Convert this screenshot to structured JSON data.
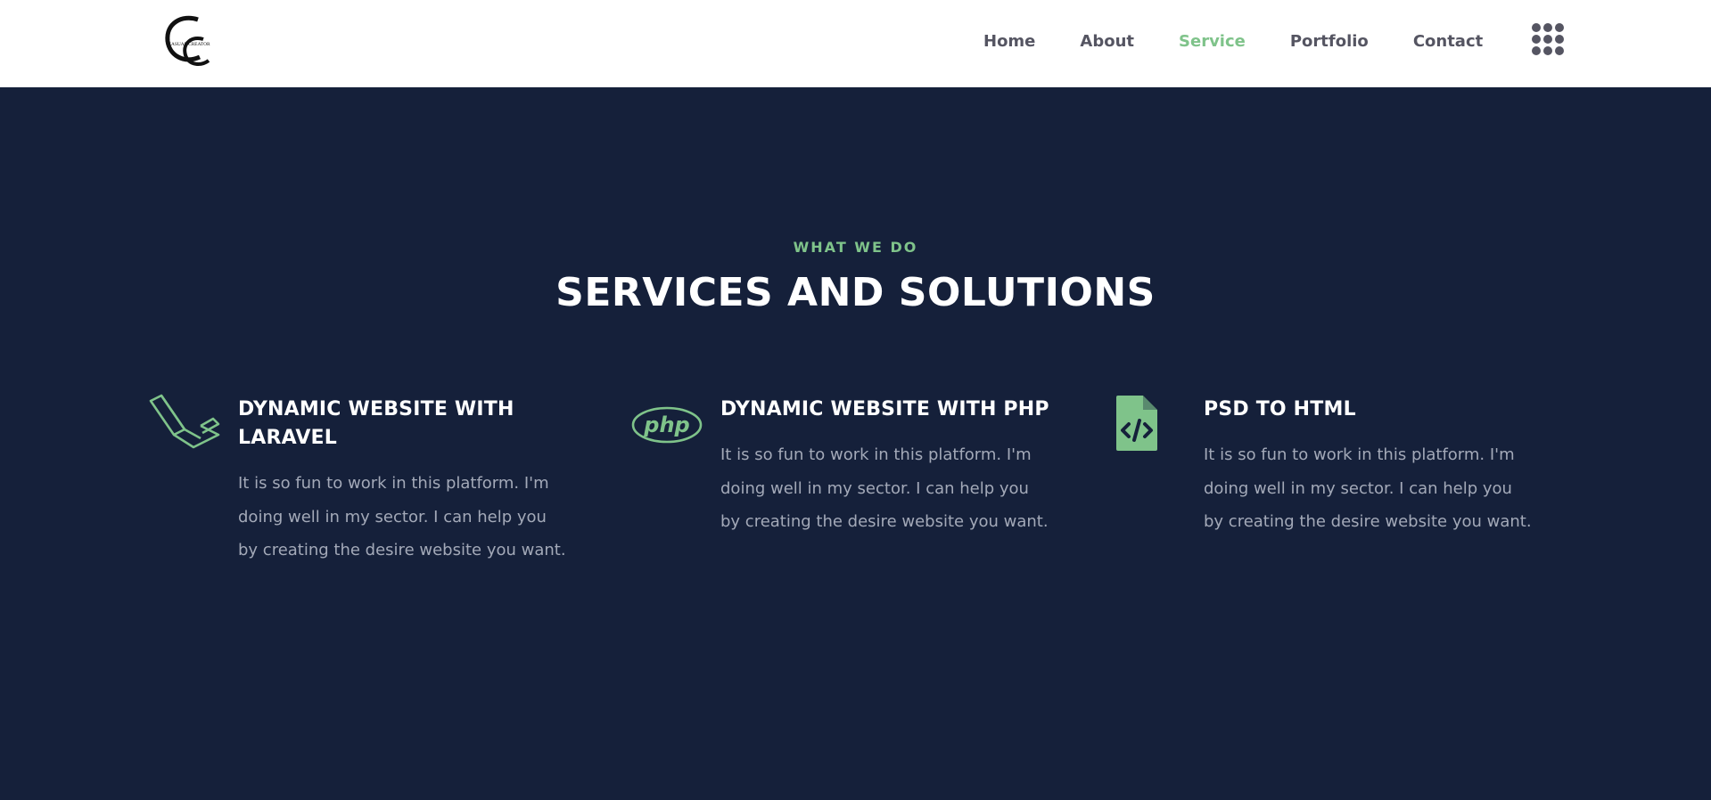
{
  "header": {
    "logo_alt": "Casual Creator logo",
    "nav": [
      {
        "label": "Home",
        "active": false
      },
      {
        "label": "About",
        "active": false
      },
      {
        "label": "Service",
        "active": true
      },
      {
        "label": "Portfolio",
        "active": false
      },
      {
        "label": "Contact",
        "active": false
      }
    ],
    "menu_icon": "grid-dots-icon"
  },
  "section": {
    "subtitle": "WHAT WE DO",
    "title": "SERVICES AND SOLUTIONS"
  },
  "services": [
    {
      "icon": "laravel-icon",
      "title_line1": "DYNAMIC WEBSITE WITH",
      "title_line2": "LARAVEL",
      "text_line1": "It is so fun to work in this platform. I'm",
      "text_line2": "doing well in my sector. I can help you",
      "text_line3": "by creating the desire website you want."
    },
    {
      "icon": "php-icon",
      "title_line1": "DYNAMIC WEBSITE WITH PHP",
      "text_line1": "It is so fun to work in this platform. I'm",
      "text_line2": "doing well in my sector. I can help you",
      "text_line3": "by creating the desire website you want."
    },
    {
      "icon": "code-file-icon",
      "title_line1": "PSD TO HTML",
      "text_line1": "It is so fun to work in this platform. I'm",
      "text_line2": "doing well in my sector. I can help you",
      "text_line3": "by creating the desire website you want."
    }
  ],
  "colors": {
    "accent": "#7fc38a",
    "background": "#15203a",
    "nav_text": "#555562",
    "body_text": "#a3a9b8"
  }
}
